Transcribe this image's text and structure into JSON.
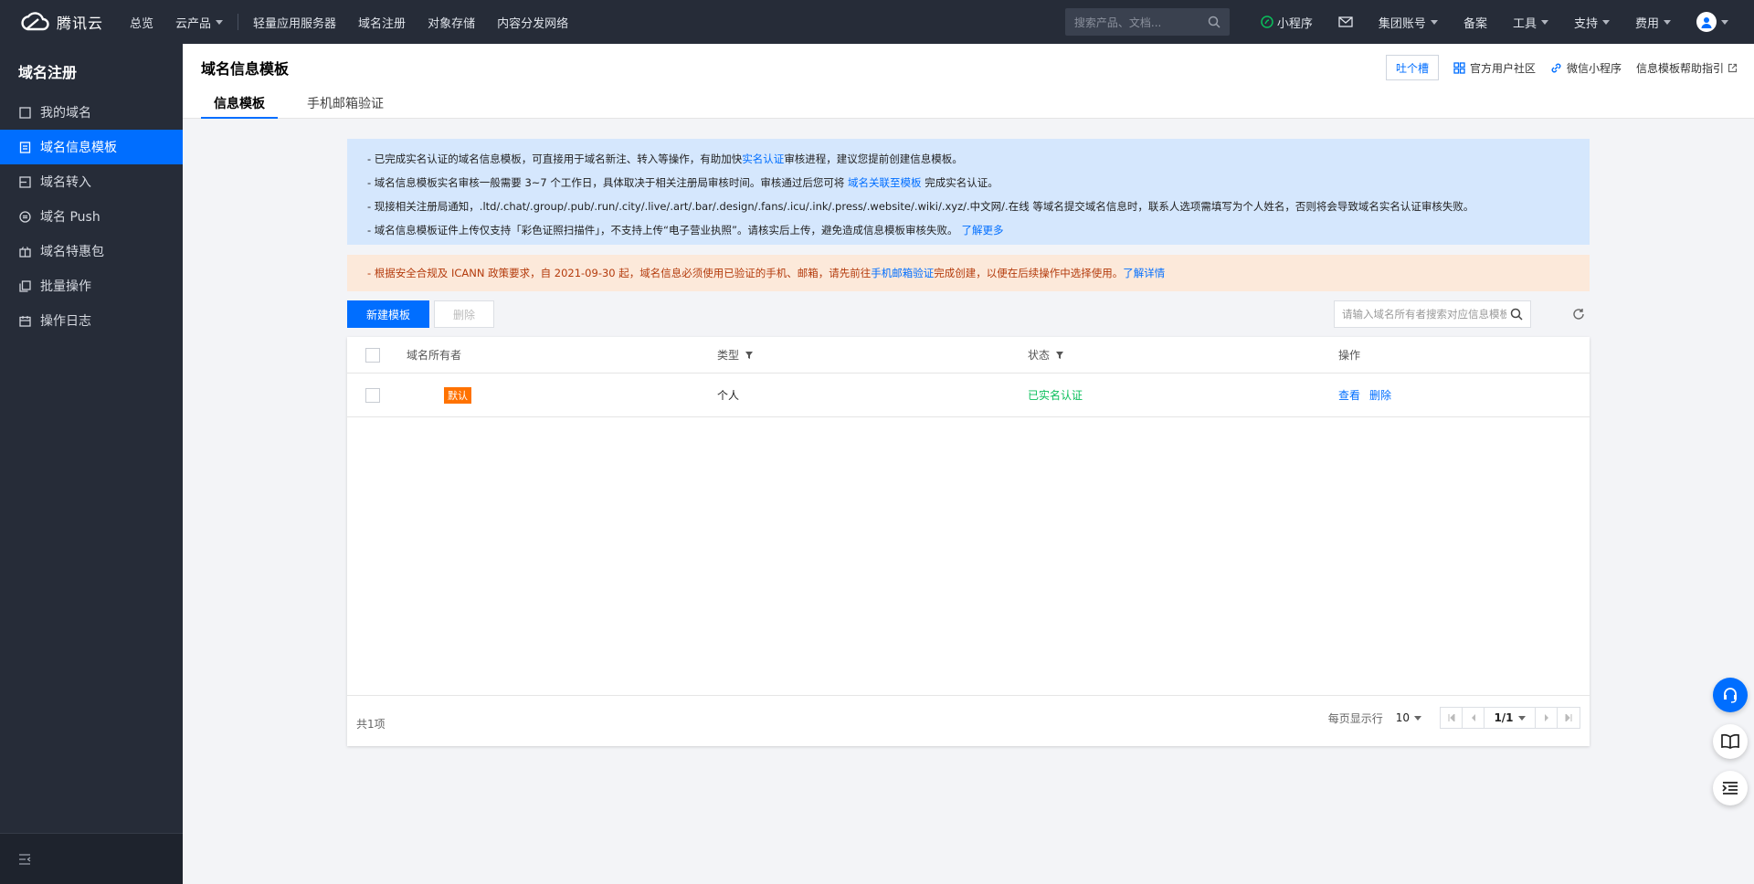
{
  "brand": {
    "name": "腾讯云"
  },
  "topnav": {
    "items": [
      "总览",
      "云产品",
      "轻量应用服务器",
      "域名注册",
      "对象存储",
      "内容分发网络"
    ],
    "search_placeholder": "搜索产品、文档...",
    "mini_program": "小程序",
    "account": "集团账号",
    "beian": "备案",
    "tools": "工具",
    "support": "支持",
    "fees": "费用"
  },
  "sidebar": {
    "title": "域名注册",
    "items": [
      {
        "label": "我的域名",
        "icon": "square-icon"
      },
      {
        "label": "域名信息模板",
        "icon": "document-icon",
        "active": true
      },
      {
        "label": "域名转入",
        "icon": "transfer-icon"
      },
      {
        "label": "域名 Push",
        "icon": "push-icon"
      },
      {
        "label": "域名特惠包",
        "icon": "gift-icon"
      },
      {
        "label": "批量操作",
        "icon": "copy-icon"
      },
      {
        "label": "操作日志",
        "icon": "calendar-icon"
      }
    ]
  },
  "header": {
    "title": "域名信息模板",
    "tabs": [
      "信息模板",
      "手机邮箱验证"
    ],
    "feedback": "吐个槽",
    "community": "官方用户社区",
    "wechat": "微信小程序",
    "help": "信息模板帮助指引"
  },
  "notice": {
    "l1a": "- 已完成实名认证的域名信息模板，可直接用于域名新注、转入等操作，有助加快",
    "l1b": "实名认证",
    "l1c": "审核进程，建议您提前创建信息模板。",
    "l2a": "- 域名信息模板实名审核一般需要 3~7 个工作日，具体取决于相关注册局审核时间。审核通过后您可将 ",
    "l2b": "域名关联至模板",
    "l2c": " 完成实名认证。",
    "l3": "- 现接相关注册局通知，.ltd/.chat/.group/.pub/.run/.city/.live/.art/.bar/.design/.fans/.icu/.ink/.press/.website/.wiki/.xyz/.中文网/.在线 等域名提交域名信息时，联系人选项需填写为个人姓名，否则将会导致域名实名认证审核失败。",
    "l4a": "- 域名信息模板证件上传仅支持「彩色证照扫描件」，不支持上传“电子营业执照”。请核实后上传，避免造成信息模板审核失败。",
    "l4b": "了解更多",
    "warn_a": "- 根据安全合规及 ICANN 政策要求，自 2021-09-30 起，域名信息必须使用已验证的手机、邮箱，请先前往",
    "warn_b": "手机邮箱验证",
    "warn_c": "完成创建，以便在后续操作中选择使用。",
    "warn_d": "了解详情"
  },
  "toolbar": {
    "new_label": "新建模板",
    "delete_label": "删除",
    "search_placeholder": "请输入域名所有者搜索对应信息模板"
  },
  "table": {
    "columns": [
      "域名所有者",
      "类型",
      "状态",
      "操作"
    ],
    "rows": [
      {
        "owner_badge": "默认",
        "type": "个人",
        "status": "已实名认证",
        "view": "查看",
        "delete": "删除"
      }
    ],
    "total": "共1项",
    "per_page_label": "每页显示行",
    "per_page": "10",
    "page": "1/1"
  },
  "colors": {
    "accent": "#006eff",
    "success": "#0abf5b",
    "badge": "#ff7200",
    "warn_text": "#b43b0c"
  }
}
